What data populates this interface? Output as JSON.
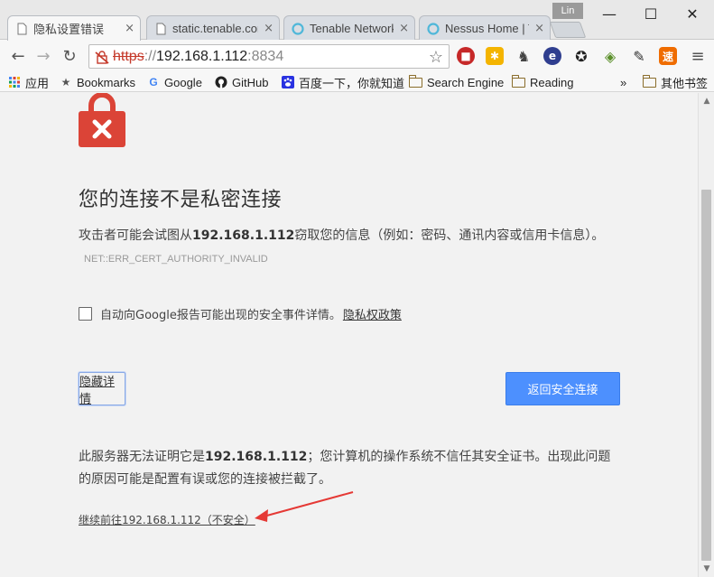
{
  "window": {
    "profile_name": "Lin",
    "minimize": "—",
    "maximize": "☐",
    "close": "✕"
  },
  "tabs": [
    {
      "title": "隐私设置错误",
      "close": "×",
      "favicon": "document-icon",
      "active": true
    },
    {
      "title": "static.tenable.cor",
      "close": "×",
      "favicon": "document-icon",
      "active": false
    },
    {
      "title": "Tenable Network",
      "close": "×",
      "favicon": "tenable-icon",
      "active": false
    },
    {
      "title": "Nessus Home | T",
      "close": "×",
      "favicon": "tenable-icon",
      "active": false
    }
  ],
  "toolbar": {
    "back": "←",
    "forward": "→",
    "reload": "↻",
    "star": "☆",
    "menu": "≡"
  },
  "address_bar": {
    "scheme": "https",
    "separator": "://",
    "host": "192.168.1.112",
    "port": ":8834"
  },
  "bookmarks": [
    {
      "label": "应用",
      "icon": "apps-grid-icon"
    },
    {
      "label": "Bookmarks",
      "icon": "star-icon"
    },
    {
      "label": "Google",
      "icon": "google-icon"
    },
    {
      "label": "GitHub",
      "icon": "github-icon"
    },
    {
      "label": "百度一下，你就知道",
      "icon": "baidu-icon"
    },
    {
      "label": "Search Engine",
      "icon": "folder-icon"
    },
    {
      "label": "Reading",
      "icon": "folder-icon"
    },
    {
      "label": "»",
      "icon": ""
    },
    {
      "label": "其他书签",
      "icon": "folder-icon"
    }
  ],
  "page": {
    "heading": "您的连接不是私密连接",
    "desc_before": "攻击者可能会试图从",
    "desc_host": "192.168.1.112",
    "desc_after": "窃取您的信息（例如：密码、通讯内容或信用卡信息）。",
    "error_code": "NET::ERR_CERT_AUTHORITY_INVALID",
    "report_label": "自动向Google报告可能出现的安全事件详情。",
    "privacy_link": "隐私权政策",
    "details_button": "隐藏详情",
    "back_button": "返回安全连接",
    "details_before": "此服务器无法证明它是",
    "details_host": "192.168.1.112",
    "details_after": "；您计算机的操作系统不信任其安全证书。出现此问题的原因可能是配置有误或您的连接被拦截了。",
    "proceed_link": "继续前往192.168.1.112（不安全）"
  },
  "colors": {
    "lock_red": "#db4437",
    "button_blue": "#4d90fe",
    "annotation_red": "#e53935"
  }
}
